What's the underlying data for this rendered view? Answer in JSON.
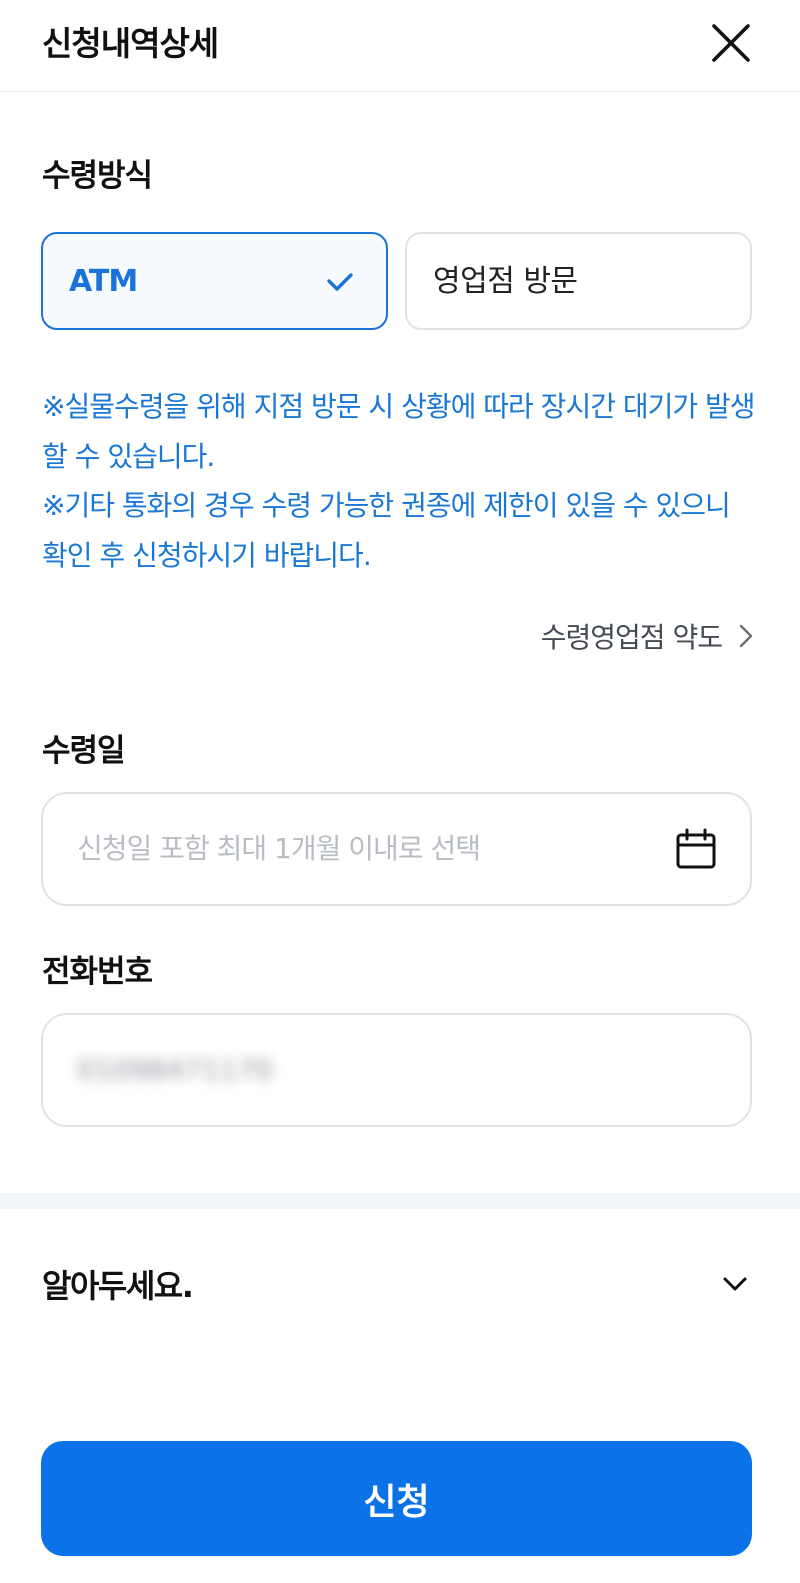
{
  "header": {
    "title": "신청내역상세",
    "close_icon": "close-icon"
  },
  "receipt_method": {
    "title": "수령방식",
    "options": [
      {
        "label": "ATM",
        "selected": true
      },
      {
        "label": "영업점 방문",
        "selected": false
      }
    ],
    "notices": [
      "※실물수령을 위해 지점 방문 시 상황에 따라 장시간 대기가 발생할 수 있습니다.",
      "※기타 통화의 경우 수령 가능한 권종에 제한이 있을 수 있으니 확인 후 신청하시기 바랍니다."
    ],
    "branch_link": "수령영업점 약도"
  },
  "receipt_date": {
    "title": "수령일",
    "placeholder": "신청일 포함 최대 1개월 이내로 선택",
    "icon": "calendar-icon"
  },
  "phone": {
    "title": "전화번호",
    "value": "01098471170"
  },
  "notice_accordion": {
    "title": "알아두세요.",
    "icon": "chevron-down-icon"
  },
  "submit": {
    "label": "신청"
  },
  "colors": {
    "accent": "#0b72e7",
    "notice_text": "#1a78d4",
    "border": "#dfe2e6"
  }
}
